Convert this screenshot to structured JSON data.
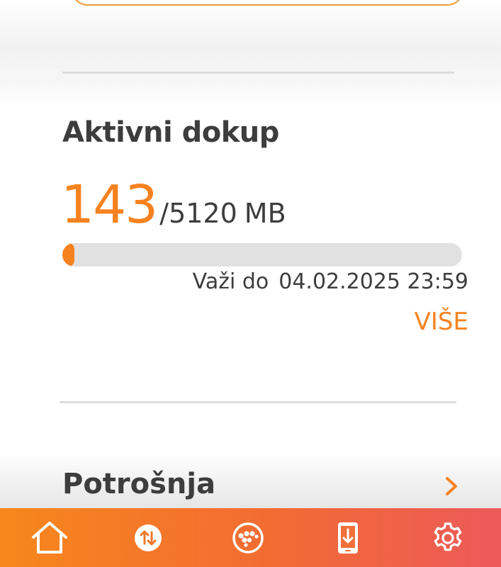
{
  "section": {
    "title": "Aktivni dokup"
  },
  "usage": {
    "used": "143",
    "slash": "/",
    "total": "5120",
    "unit": "MB",
    "fraction_used": 0.028
  },
  "validity": {
    "label": "Važi do",
    "date": "04.02.2025 23:59"
  },
  "more_label": "VIŠE",
  "row": {
    "title": "Potrošnja"
  },
  "bottom_nav": [
    {
      "icon": "home-icon"
    },
    {
      "icon": "transfer-arrows-icon"
    },
    {
      "icon": "operator-logo-icon"
    },
    {
      "icon": "phone-download-icon"
    },
    {
      "icon": "settings-gear-icon"
    }
  ],
  "colors": {
    "accent": "#f6821f",
    "text": "#3d3d3d",
    "track": "#e1e1e1",
    "nav_gradient_start": "#f7871c",
    "nav_gradient_end": "#ec5a5a"
  }
}
